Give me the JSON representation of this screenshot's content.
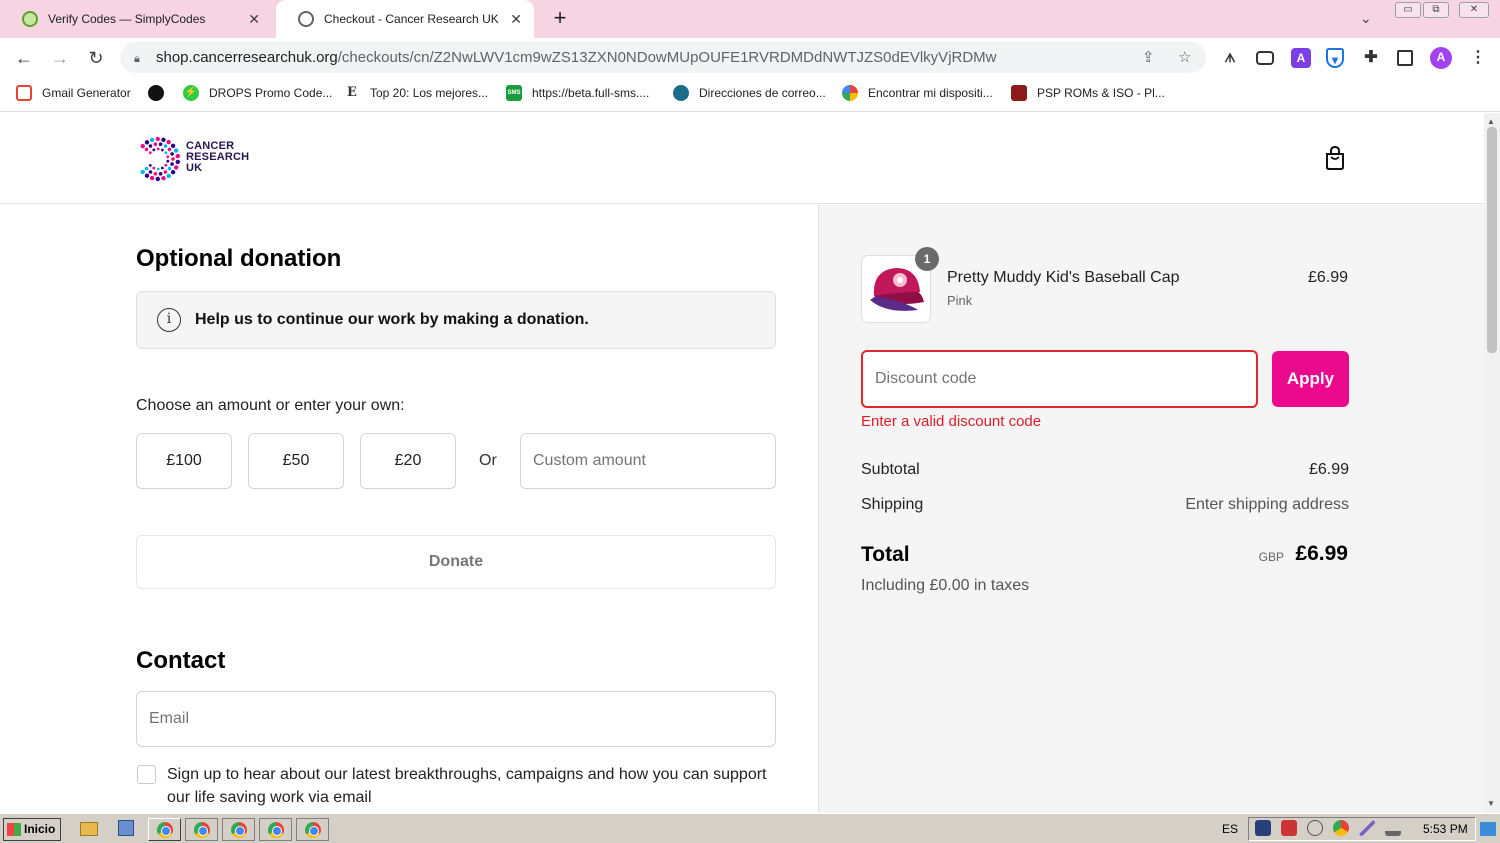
{
  "browser": {
    "tabs": [
      {
        "title": "Verify Codes — SimplyCodes",
        "active": false
      },
      {
        "title": "Checkout - Cancer Research UK",
        "active": true
      }
    ],
    "url_host": "shop.cancerresearchuk.org",
    "url_path": "/checkouts/cn/Z2NwLWV1cm9wZS13ZXN0NDowMUpOUFE1RVRDMDdNWTJZS0dEVlkyVjRDMw",
    "profile_initial": "A",
    "bookmarks": [
      {
        "label": "Gmail Generator",
        "icon_color": "#ea4335"
      },
      {
        "label": "",
        "icon_color": "#111111"
      },
      {
        "label": "DROPS Promo Code...",
        "icon_color": "#2ecc40"
      },
      {
        "label": "Top 20: Los mejores...",
        "icon_color": "#333333"
      },
      {
        "label": "https://beta.full-sms....",
        "icon_color": "#1a9c3a"
      },
      {
        "label": "Direcciones de correo...",
        "icon_color": "#1b6b8a"
      },
      {
        "label": "Encontrar mi dispositi...",
        "icon_color": "#4285f4"
      },
      {
        "label": "PSP ROMs & ISO - Pl...",
        "icon_color": "#8b1a1a"
      }
    ]
  },
  "header": {
    "logo_lines": [
      "CANCER",
      "RESEARCH",
      "UK"
    ],
    "cart_icon": "shopping-bag-icon"
  },
  "donation": {
    "heading": "Optional donation",
    "info_text": "Help us to continue our work by making a donation.",
    "choose_label": "Choose an amount or enter your own:",
    "amounts": [
      "£100",
      "£50",
      "£20"
    ],
    "or_label": "Or",
    "custom_placeholder": "Custom amount",
    "donate_label": "Donate"
  },
  "contact": {
    "heading": "Contact",
    "email_placeholder": "Email",
    "newsletter_label": "Sign up to hear about our latest breakthroughs, campaigns and how you can support our life saving work via email"
  },
  "summary": {
    "product": {
      "name": "Pretty Muddy Kid's Baseball Cap",
      "variant": "Pink",
      "price": "£6.99",
      "quantity": "1"
    },
    "discount_placeholder": "Discount code",
    "apply_label": "Apply",
    "discount_error": "Enter a valid discount code",
    "subtotal_label": "Subtotal",
    "subtotal_value": "£6.99",
    "shipping_label": "Shipping",
    "shipping_value": "Enter shipping address",
    "total_label": "Total",
    "total_currency": "GBP",
    "total_value": "£6.99",
    "taxes_text": "Including £0.00 in taxes"
  },
  "taskbar": {
    "start_label": "Inicio",
    "language": "ES",
    "clock": "5:53 PM"
  },
  "colors": {
    "accent": "#ec0a8c",
    "error": "#dd1d2a",
    "tabstrip": "#f6d4e1"
  }
}
